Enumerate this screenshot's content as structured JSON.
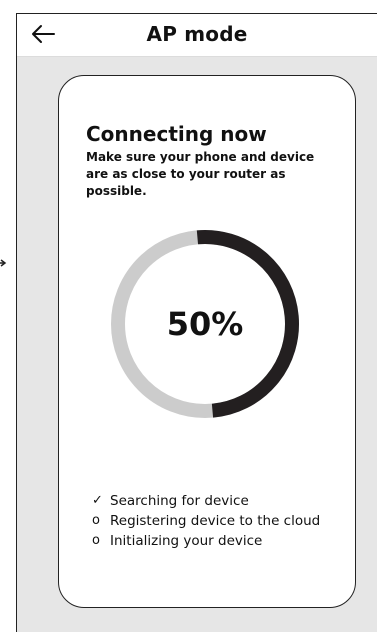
{
  "header": {
    "title": "AP mode"
  },
  "card": {
    "title": "Connecting now",
    "subtitle_line1": "Make sure your phone and device",
    "subtitle_line2": "are as close to your router as possible."
  },
  "progress": {
    "value": 0.5,
    "label": "50%"
  },
  "steps": [
    {
      "marker": "✓",
      "label": "Searching for device",
      "status": "done"
    },
    {
      "marker": "o",
      "label": "Registering device to the cloud",
      "status": "pending"
    },
    {
      "marker": "o",
      "label": "Initializing your device",
      "status": "pending"
    }
  ],
  "colors": {
    "progress_track": "#cccccc",
    "progress_fill": "#231f20",
    "content_background": "#e6e6e6"
  },
  "icons": {
    "back": "arrow-left-icon"
  }
}
